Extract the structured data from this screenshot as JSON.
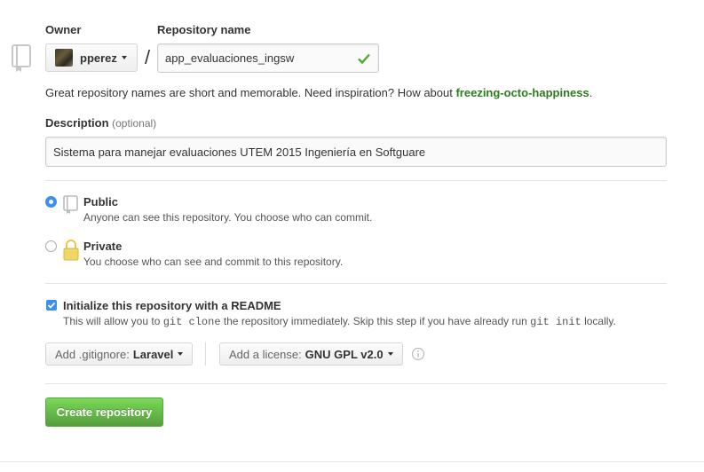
{
  "owner": {
    "label": "Owner",
    "name": "pperez"
  },
  "repository": {
    "label": "Repository name",
    "separator": "/",
    "value": "app_evaluaciones_ingsw"
  },
  "hint": {
    "text": "Great repository names are short and memorable. Need inspiration? How about ",
    "suggestion": "freezing-octo-happiness",
    "end": "."
  },
  "description": {
    "label": "Description",
    "optional": "(optional)",
    "value": "Sistema para manejar evaluaciones UTEM 2015 Ingeniería en Softguare"
  },
  "visibility": {
    "public": {
      "title": "Public",
      "desc": "Anyone can see this repository. You choose who can commit.",
      "selected": true
    },
    "private": {
      "title": "Private",
      "desc": "You choose who can see and commit to this repository.",
      "selected": false
    }
  },
  "readme": {
    "checked": true,
    "title": "Initialize this repository with a README",
    "desc_1": "This will allow you to ",
    "code_1": "git clone",
    "desc_2": " the repository immediately. Skip this step if you have already run ",
    "code_2": "git init",
    "desc_3": " locally."
  },
  "gitignore": {
    "prefix": "Add .gitignore:",
    "value": "Laravel"
  },
  "license": {
    "prefix": "Add a license:",
    "value": "GNU GPL v2.0"
  },
  "create_button": "Create repository",
  "colors": {
    "accent_blue": "#3b8ff0",
    "success_green": "#2d7a1f",
    "button_green": "#569e3d"
  }
}
